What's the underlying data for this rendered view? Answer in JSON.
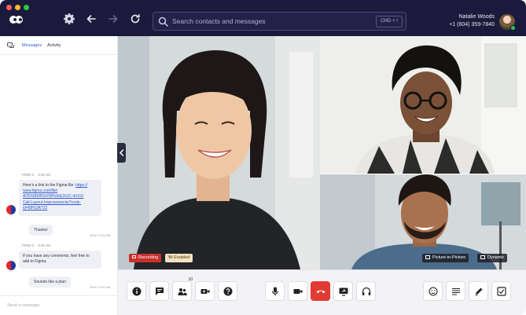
{
  "window": {
    "traffic_lights": [
      "close",
      "minimize",
      "zoom"
    ]
  },
  "header": {
    "search": {
      "placeholder": "Search contacts and messages",
      "shortcut": "CMD + /"
    },
    "user": {
      "name": "Natalie Woods",
      "phone": "+1 (604) 359-7840",
      "status": "online"
    },
    "icons": [
      "logo",
      "gear-icon",
      "back-arrow-icon",
      "forward-arrow-icon",
      "refresh-icon",
      "search-icon"
    ]
  },
  "sidebar": {
    "tabs": [
      {
        "label": "Messages",
        "active": true
      },
      {
        "label": "Activity",
        "active": false
      }
    ],
    "messages": [
      {
        "sender": "FRED C.",
        "time": "9:05 AM",
        "lines": [
          "Here's a link to the Figma file: ",
          "www.figma.com/file/",
          "AD5Xt8WRSrH9Pw6EZtUC-4XXX/",
          "Call-Layout-Improvements?node-",
          "id=88%3A722"
        ],
        "link_label": "https://"
      },
      {
        "text": "Thanks!",
        "sent": "SENT 9:23 AM"
      },
      {
        "sender": "FRED C.",
        "time": "9:30 AM",
        "lines": [
          "If you have any comments, feel free to",
          "add to Figma."
        ]
      },
      {
        "text": "Sounds like a plan",
        "sent": "SENT 9:33 AM"
      }
    ],
    "compose_placeholder": "Send a message"
  },
  "video": {
    "recording_label": "Recording",
    "vi_badge": "Vi",
    "vi_label": "Enabled",
    "pip_label": "Picture-in-Picture",
    "dynamic_label": "Dynamic"
  },
  "toolbar": {
    "participants_count": "10",
    "buttons": [
      "info",
      "chat",
      "participants",
      "add-video",
      "help",
      "microphone",
      "camera",
      "hang-up",
      "screen-share",
      "headphones",
      "emoji",
      "notes",
      "edit",
      "tasks"
    ]
  },
  "colors": {
    "header_bg": "#1c1a3c",
    "accent": "#2d59c8",
    "hangup": "#e23b33",
    "recording": "#c9302c"
  }
}
